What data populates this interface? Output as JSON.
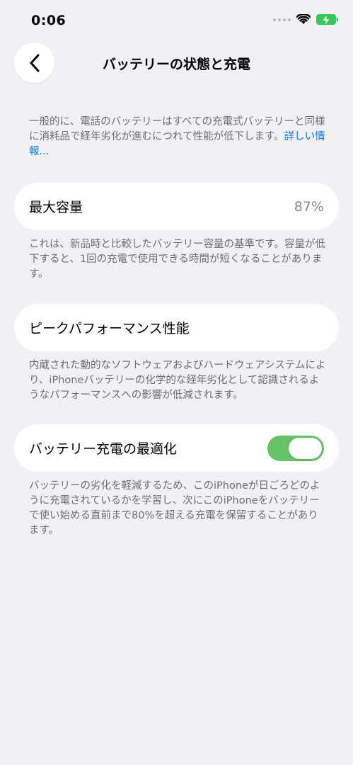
{
  "status_bar": {
    "time": "0:06"
  },
  "nav": {
    "title": "バッテリーの状態と充電"
  },
  "intro": {
    "text": "一般的に、電話のバッテリーはすべての充電式バッテリーと同様に消耗品で経年劣化が進むにつれて性能が低下します。",
    "link": "詳しい情報..."
  },
  "max_capacity": {
    "label": "最大容量",
    "value": "87%",
    "description": "これは、新品時と比較したバッテリー容量の基準です。容量が低下すると、1回の充電で使用できる時間が短くなることがあります。"
  },
  "peak_performance": {
    "label": "ピークパフォーマンス性能",
    "description": "内蔵された動的なソフトウェアおよびハードウェアシステムにより、iPhoneバッテリーの化学的な経年劣化として認識されるようなパフォーマンスへの影響が低減されます。"
  },
  "optimized_charging": {
    "label": "バッテリー充電の最適化",
    "toggle_on": true,
    "description": "バッテリーの劣化を軽減するため、このiPhoneが日ごろどのように充電されているかを学習し、次にこのiPhoneをバッテリーで使い始める直前まで80%を超える充電を保留することがあります。"
  },
  "colors": {
    "background": "#f0f0f5",
    "link": "#007aff",
    "toggle_on": "#65c466",
    "battery": "#34c759"
  }
}
